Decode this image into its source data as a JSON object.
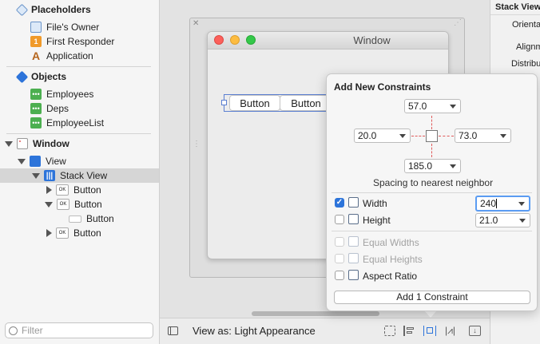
{
  "outline": {
    "placeholders_header": "Placeholders",
    "files_owner": "File's Owner",
    "first_responder": "First Responder",
    "application": "Application",
    "objects_header": "Objects",
    "employees": "Employees",
    "deps": "Deps",
    "employee_list": "EmployeeList",
    "window": "Window",
    "view": "View",
    "stack_view": "Stack View",
    "button_1": "Button",
    "button_2": "Button",
    "button_2_child": "Button",
    "button_3": "Button",
    "filter_placeholder": "Filter"
  },
  "canvas": {
    "window_title": "Window",
    "stack_button_1": "Button",
    "stack_button_2": "Button",
    "view_as_label": "View as: Light Appearance"
  },
  "inspector": {
    "title": "Stack View",
    "orientation": "Orienta",
    "alignment": "Alignm",
    "distribution": "Distribu"
  },
  "constraints_popover": {
    "title": "Add New Constraints",
    "top_value": "57.0",
    "left_value": "20.0",
    "right_value": "73.0",
    "bottom_value": "185.0",
    "spacing_caption": "Spacing to nearest neighbor",
    "width_label": "Width",
    "width_checked": true,
    "width_value": "240",
    "height_label": "Height",
    "height_checked": false,
    "height_value": "21.0",
    "equal_widths_label": "Equal Widths",
    "equal_heights_label": "Equal Heights",
    "aspect_ratio_label": "Aspect Ratio",
    "add_button_label": "Add 1 Constraint"
  },
  "colors": {
    "accent_blue": "#2d74da",
    "constraint_red": "#e05a5a",
    "object_green": "#4caf50",
    "responder_orange": "#f09a2a"
  }
}
